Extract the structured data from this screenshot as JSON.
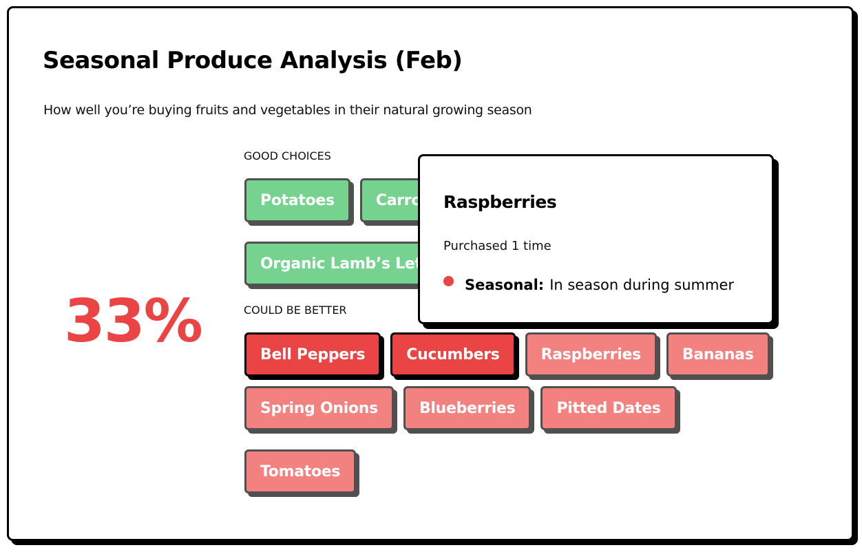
{
  "header": {
    "title": "Seasonal Produce Analysis (Feb)",
    "subtitle": "How well you’re buying fruits and vegetables in their natural growing season"
  },
  "score": {
    "value": "33%",
    "color": "#ea4444"
  },
  "good_choices": {
    "label": "GOOD CHOICES",
    "color": "#76d38f",
    "items": [
      {
        "label": "Potatoes"
      },
      {
        "label": "Carrots"
      },
      {
        "label": "Organic Lamb’s Lettuce"
      }
    ]
  },
  "could_be_better": {
    "label": "COULD BE BETTER",
    "strong_color": "#ea4444",
    "soft_color": "#f3817f",
    "items": [
      {
        "label": "Bell Peppers",
        "level": "strong"
      },
      {
        "label": "Cucumbers",
        "level": "strong"
      },
      {
        "label": "Raspberries",
        "level": "soft"
      },
      {
        "label": "Bananas",
        "level": "soft"
      },
      {
        "label": "Spring Onions",
        "level": "soft"
      },
      {
        "label": "Blueberries",
        "level": "soft"
      },
      {
        "label": "Pitted Dates",
        "level": "soft"
      },
      {
        "label": "Tomatoes",
        "level": "soft"
      }
    ]
  },
  "tooltip": {
    "title": "Raspberries",
    "purchased": "Purchased 1 time",
    "status_icon": "red-dot-icon",
    "status_key": "Seasonal:",
    "status_value": "In season during summer"
  }
}
